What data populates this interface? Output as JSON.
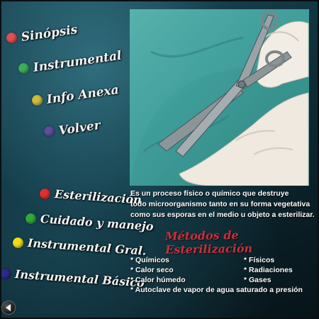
{
  "top_menu": [
    {
      "label": "Sinópsis",
      "color": "#e05050"
    },
    {
      "label": "Instrumental",
      "color": "#3dae5a"
    },
    {
      "label": "Info Anexa",
      "color": "#cdbd3a"
    },
    {
      "label": "Volver",
      "color": "#5d4f9a"
    }
  ],
  "bottom_menu": [
    {
      "label": "Esterilización",
      "color": "#e02f2f"
    },
    {
      "label": "Cuidado y manejo",
      "color": "#2faa3a"
    },
    {
      "label": "Instrumental Gral.",
      "color": "#f0dc1c"
    },
    {
      "label": "Instrumental Básico",
      "color": "#2d2a8a"
    }
  ],
  "description": {
    "line1": "Es un proceso físico o químico que destruye",
    "line2": "todo microorganismo tanto en su forma vegetativa",
    "line3": "como sus esporas en el medio u objeto a esterilizar."
  },
  "methods_title": "Métodos de Esterilización",
  "methods_left": [
    "Químicos",
    "Calor seco",
    "Calor húmedo"
  ],
  "methods_right": [
    "Físicos",
    "Radiaciones",
    "Gases"
  ],
  "methods_full": "Autoclave de vapor de agua saturado a presión",
  "colors": {
    "title_red": "#c7303a",
    "drape": "#3f9d99",
    "glove": "#efe9df"
  },
  "icons": {
    "back": "left-triangle-icon",
    "photo": "surgical-scissors-photo"
  }
}
